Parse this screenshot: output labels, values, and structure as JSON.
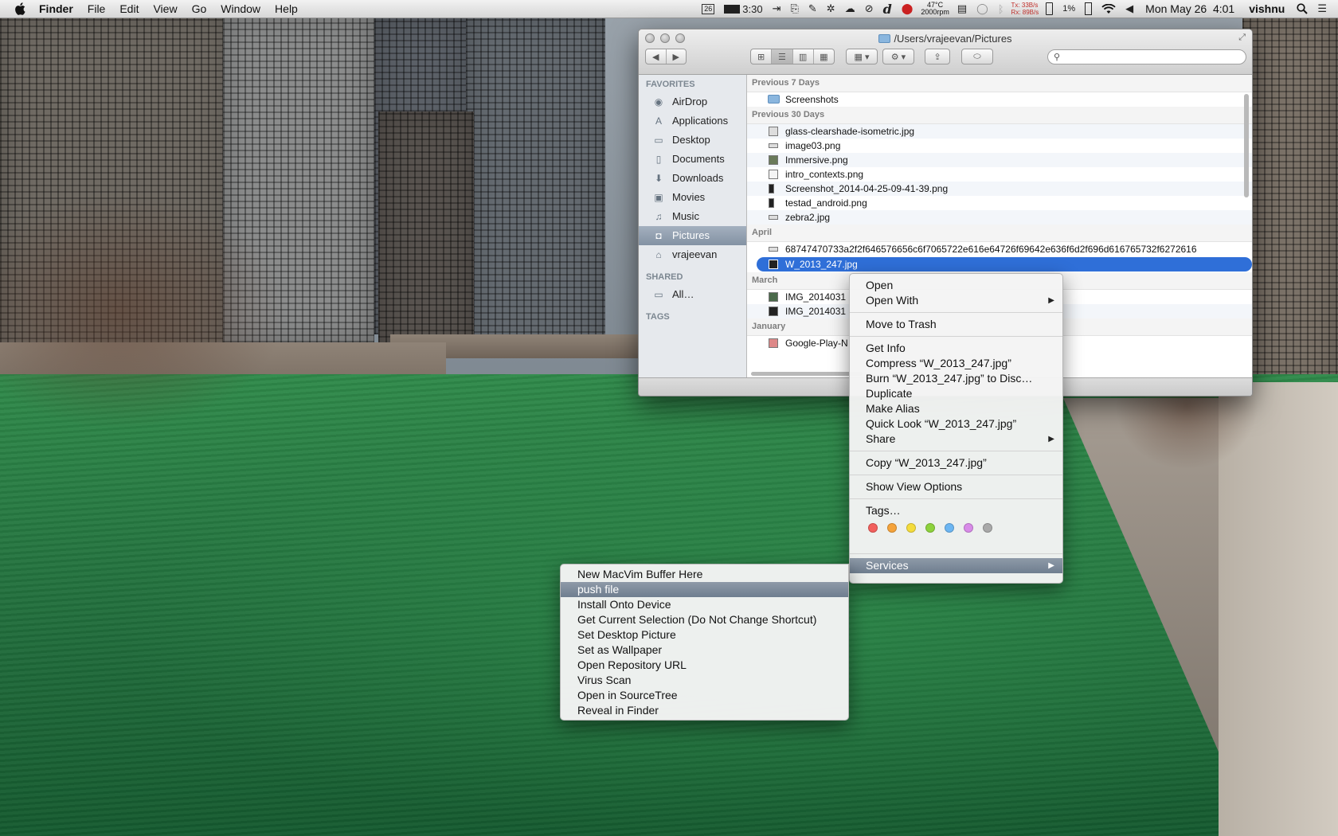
{
  "menubar": {
    "apple_icon": "apple-icon",
    "app_name": "Finder",
    "menus": [
      "File",
      "Edit",
      "View",
      "Go",
      "Window",
      "Help"
    ],
    "status": {
      "calendar_badge": "26",
      "time_remaining": "3:30",
      "temperature": "47°C",
      "fan_speed": "2000rpm",
      "tx_label": "Tx:",
      "rx_label": "Rx:",
      "tx_rate": "33B/s",
      "rx_rate": "89B/s",
      "battery_percent": "1%",
      "clock": "Mon May 26  4:01",
      "user": "vishnu"
    }
  },
  "finder": {
    "title": "/Users/vrajeevan/Pictures",
    "sidebar": {
      "favorites_header": "FAVORITES",
      "favorites": [
        {
          "label": "AirDrop",
          "icon": "airdrop-icon"
        },
        {
          "label": "Applications",
          "icon": "applications-icon"
        },
        {
          "label": "Desktop",
          "icon": "desktop-icon"
        },
        {
          "label": "Documents",
          "icon": "documents-icon"
        },
        {
          "label": "Downloads",
          "icon": "downloads-icon"
        },
        {
          "label": "Movies",
          "icon": "movies-icon"
        },
        {
          "label": "Music",
          "icon": "music-icon"
        },
        {
          "label": "Pictures",
          "icon": "pictures-icon",
          "selected": true
        },
        {
          "label": "vrajeevan",
          "icon": "home-icon"
        }
      ],
      "shared_header": "SHARED",
      "shared": [
        {
          "label": "All…",
          "icon": "network-icon"
        }
      ],
      "tags_header": "TAGS"
    },
    "groups": [
      {
        "title": "Previous 7 Days",
        "files": [
          "Screenshots"
        ]
      },
      {
        "title": "Previous 30 Days",
        "files": [
          "glass-clearshade-isometric.jpg",
          "image03.png",
          "Immersive.png",
          "intro_contexts.png",
          "Screenshot_2014-04-25-09-41-39.png",
          "testad_android.png",
          "zebra2.jpg"
        ]
      },
      {
        "title": "April",
        "files": [
          "68747470733a2f2f646576656c6f7065722e616e64726f69642e636f6d2f696d616765732f6272616",
          "W_2013_247.jpg"
        ]
      },
      {
        "title": "March",
        "files": [
          "IMG_2014031",
          "IMG_2014031"
        ]
      },
      {
        "title": "January",
        "files": [
          "Google-Play-N"
        ]
      }
    ]
  },
  "context_menu": {
    "items": [
      {
        "label": "Open"
      },
      {
        "label": "Open With",
        "submenu": true
      },
      {
        "label": "Move to Trash"
      },
      {
        "label": "Get Info"
      },
      {
        "label": "Compress “W_2013_247.jpg”"
      },
      {
        "label": "Burn “W_2013_247.jpg” to Disc…"
      },
      {
        "label": "Duplicate"
      },
      {
        "label": "Make Alias"
      },
      {
        "label": "Quick Look “W_2013_247.jpg”"
      },
      {
        "label": "Share",
        "submenu": true
      },
      {
        "label": "Copy “W_2013_247.jpg”"
      },
      {
        "label": "Show View Options"
      },
      {
        "label": "Tags…"
      },
      {
        "label": "Services",
        "submenu": true
      }
    ],
    "tag_colors": [
      "#f25f5c",
      "#f5a33a",
      "#f4dc3c",
      "#8dd23c",
      "#6cb6f2",
      "#d88be8",
      "#a9a9a9"
    ]
  },
  "services_menu": {
    "items": [
      "New MacVim Buffer Here",
      "push file",
      "Install Onto Device",
      "Get Current Selection (Do Not Change Shortcut)",
      "Set Desktop Picture",
      "Set as Wallpaper",
      "Open Repository URL",
      "Virus Scan",
      "Open in SourceTree",
      "Reveal in Finder"
    ]
  },
  "colors": {
    "selection_blue": "#2f6fd8",
    "menu_highlight": "#7a8797",
    "river_green": "#2f8a4a"
  }
}
